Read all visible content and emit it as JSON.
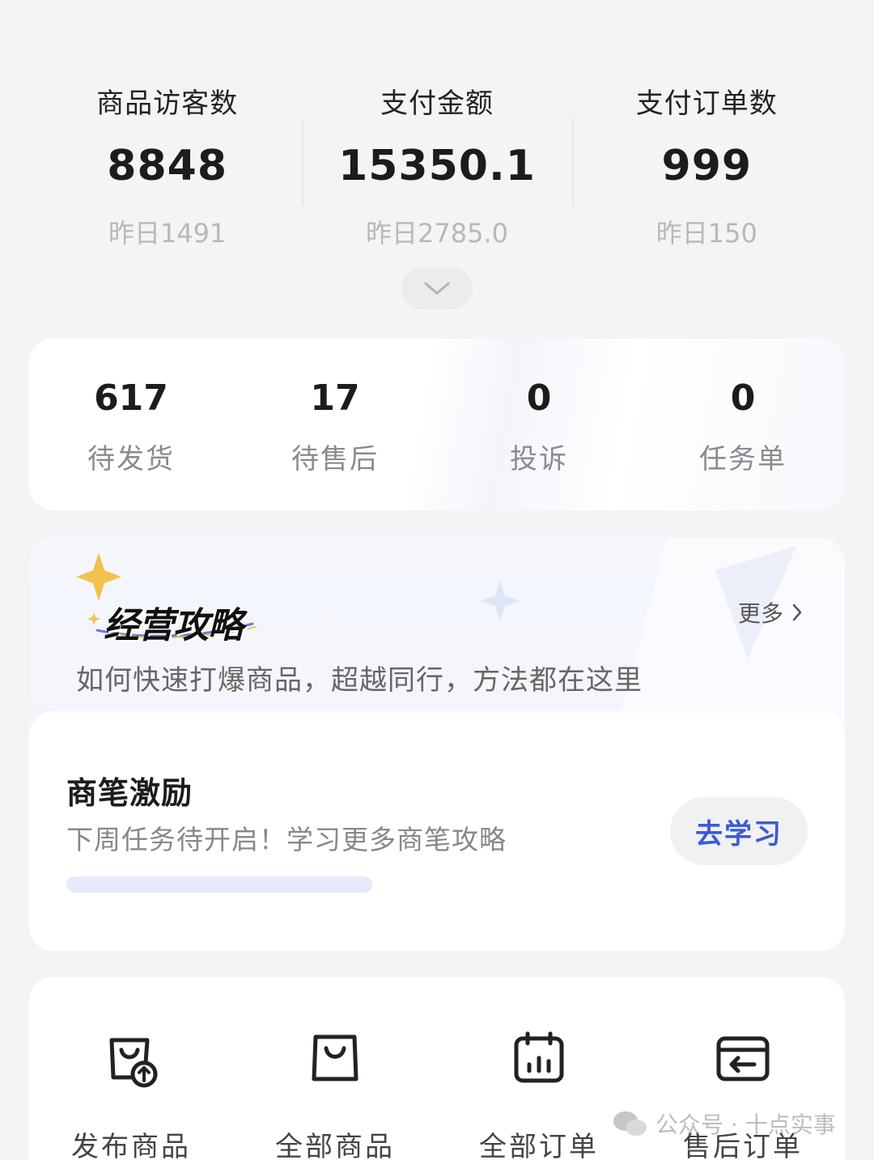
{
  "stats": [
    {
      "label": "商品访客数",
      "value": "8848",
      "sub": "昨日1491"
    },
    {
      "label": "支付金额",
      "value": "15350.1",
      "sub": "昨日2785.0"
    },
    {
      "label": "支付订单数",
      "value": "999",
      "sub": "昨日150"
    }
  ],
  "orders": [
    {
      "value": "617",
      "label": "待发货"
    },
    {
      "value": "17",
      "label": "待售后"
    },
    {
      "value": "0",
      "label": "投诉"
    },
    {
      "value": "0",
      "label": "任务单"
    }
  ],
  "strategy": {
    "title": "经营攻略",
    "more": "更多",
    "desc": "如何快速打爆商品，超越同行，方法都在这里",
    "incentive": {
      "title": "商笔激励",
      "desc": "下周任务待开启！学习更多商笔攻略",
      "button": "去学习",
      "progress": 0
    }
  },
  "tools": [
    {
      "label": "发布商品",
      "icon": "publish-product-icon"
    },
    {
      "label": "全部商品",
      "icon": "shopping-bag-icon"
    },
    {
      "label": "全部订单",
      "icon": "order-calendar-icon"
    },
    {
      "label": "售后订单",
      "icon": "after-sales-icon"
    }
  ],
  "watermark": {
    "text": "公众号 · 十点实事"
  },
  "colors": {
    "accent": "#3a5ad9",
    "background": "#f4f4f6",
    "star": "#f2c14e"
  }
}
